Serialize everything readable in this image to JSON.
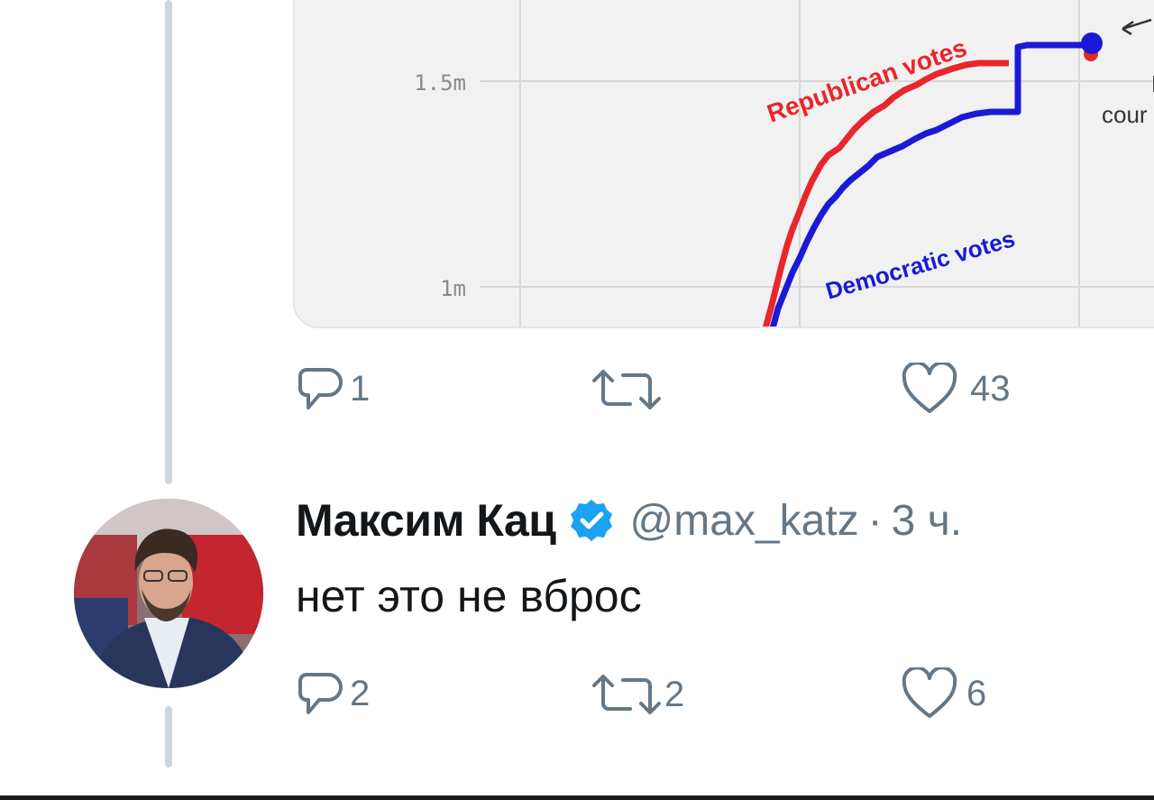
{
  "chart": {
    "ytick_upper": "1.5m",
    "ytick_lower": "1m",
    "republican_label": "Republican votes",
    "democratic_label": "Democratic votes",
    "annotation_line1": "E",
    "annotation_line2": "cour",
    "republican_color": "#e8262b",
    "democratic_color": "#1a1ad6"
  },
  "previous_tweet": {
    "actions": {
      "reply_count": "1",
      "retweet_count": "",
      "like_count": "43"
    }
  },
  "reply_tweet": {
    "author": {
      "display_name": "Максим Кац",
      "handle": "@max_katz",
      "verified": true
    },
    "separator": "·",
    "time": "3 ч.",
    "text": "нет это не вброс",
    "actions": {
      "reply_count": "2",
      "retweet_count": "2",
      "like_count": "6"
    }
  },
  "colors": {
    "action_gray": "#657786",
    "thread_line": "#ccd6dd",
    "verified_blue": "#1da1f2"
  }
}
